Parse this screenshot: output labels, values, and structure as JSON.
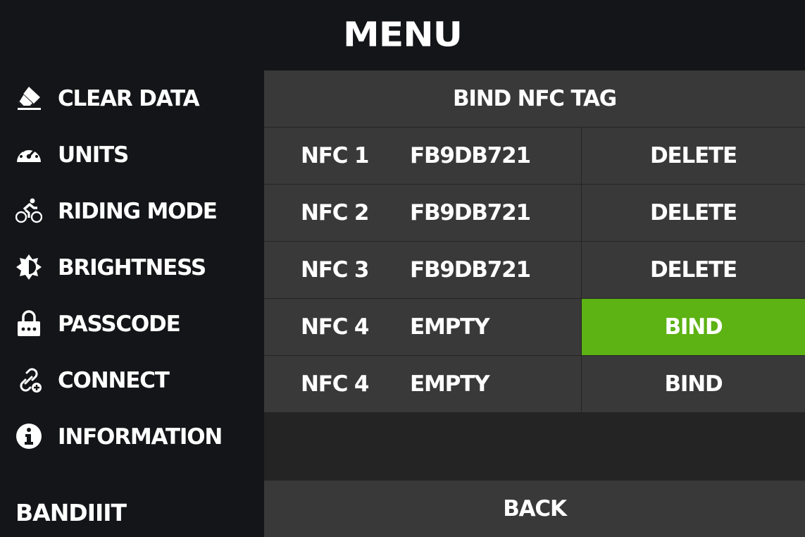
{
  "header": {
    "title": "MENU"
  },
  "sidebar": {
    "items": [
      {
        "label": "CLEAR DATA",
        "icon": "eraser-icon"
      },
      {
        "label": "UNITS",
        "icon": "speedometer-icon"
      },
      {
        "label": "RIDING MODE",
        "icon": "cyclist-icon"
      },
      {
        "label": "BRIGHTNESS",
        "icon": "brightness-icon"
      },
      {
        "label": "PASSCODE",
        "icon": "lock-icon"
      },
      {
        "label": "CONNECT",
        "icon": "link-plus-icon"
      },
      {
        "label": "INFORMATION",
        "icon": "info-icon"
      }
    ],
    "brand": "BANDIIIT"
  },
  "panel": {
    "title": "BIND NFC TAG",
    "rows": [
      {
        "name": "NFC 1",
        "value": "FB9DB721",
        "action": "DELETE"
      },
      {
        "name": "NFC 2",
        "value": "FB9DB721",
        "action": "DELETE"
      },
      {
        "name": "NFC 3",
        "value": "FB9DB721",
        "action": "DELETE"
      },
      {
        "name": "NFC 4",
        "value": "EMPTY",
        "action": "BIND",
        "highlighted": true
      },
      {
        "name": "NFC 4",
        "value": "EMPTY",
        "action": "BIND"
      }
    ],
    "back_label": "BACK"
  },
  "colors": {
    "background": "#141518",
    "panel": "#242424",
    "cell": "#393939",
    "accent": "#5db214",
    "text": "#ffffff"
  }
}
